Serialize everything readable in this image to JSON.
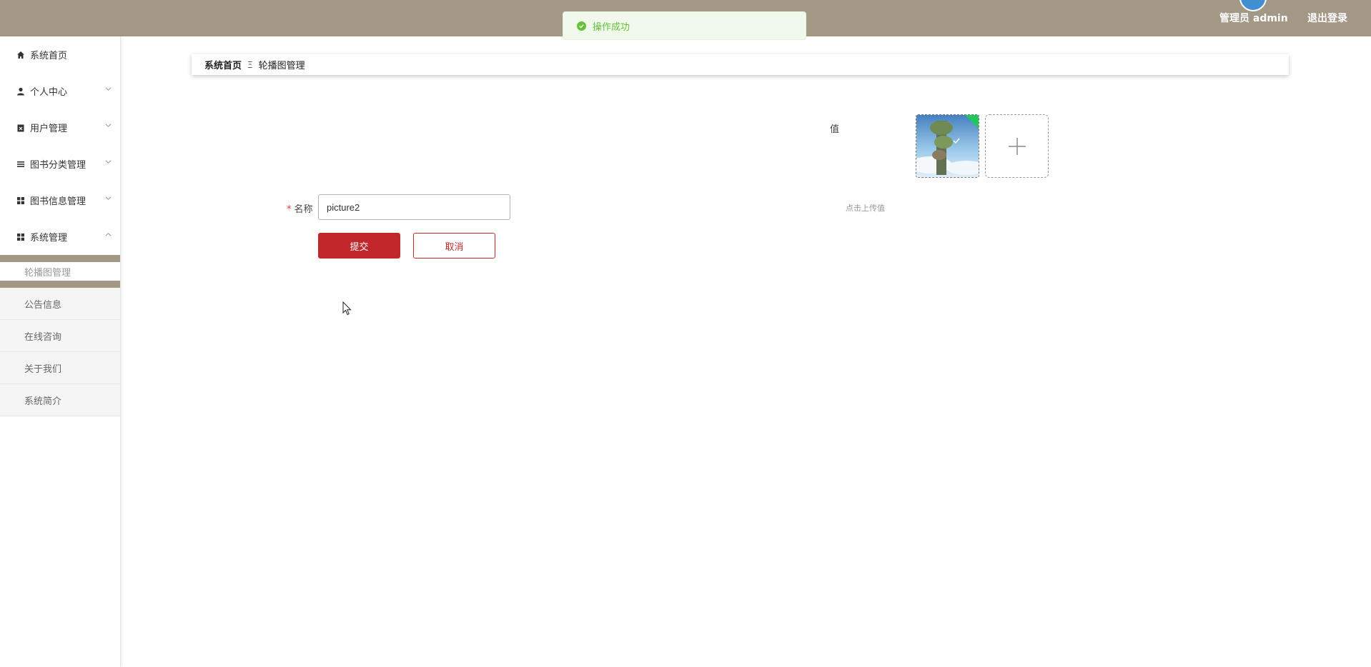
{
  "header": {
    "admin_label": "管理员 admin",
    "logout_label": "退出登录",
    "background": "#a29885"
  },
  "toast": {
    "message": "操作成功",
    "color": "#67c23a"
  },
  "sidebar": {
    "items": [
      {
        "label": "系统首页",
        "icon": "home-icon"
      },
      {
        "label": "个人中心",
        "icon": "user-icon",
        "expandable": true
      },
      {
        "label": "用户管理",
        "icon": "clipboard-icon",
        "expandable": true
      },
      {
        "label": "图书分类管理",
        "icon": "list-icon",
        "expandable": true
      },
      {
        "label": "图书信息管理",
        "icon": "grid-icon",
        "expandable": true
      },
      {
        "label": "系统管理",
        "icon": "grid-icon",
        "expandable": true,
        "expanded": true
      }
    ],
    "sub_items": [
      {
        "label": "轮播图管理",
        "active": true
      },
      {
        "label": "公告信息"
      },
      {
        "label": "在线咨询"
      },
      {
        "label": "关于我们"
      },
      {
        "label": "系统简介"
      }
    ]
  },
  "breadcrumb": {
    "home": "系统首页",
    "separator": "Ξ",
    "current": "轮播图管理"
  },
  "form": {
    "value_label": "值",
    "name_label": "名称",
    "name_value": "picture2",
    "upload_hint": "点击上传值",
    "submit_label": "提交",
    "cancel_label": "取消",
    "accent_color": "#c0282b"
  }
}
